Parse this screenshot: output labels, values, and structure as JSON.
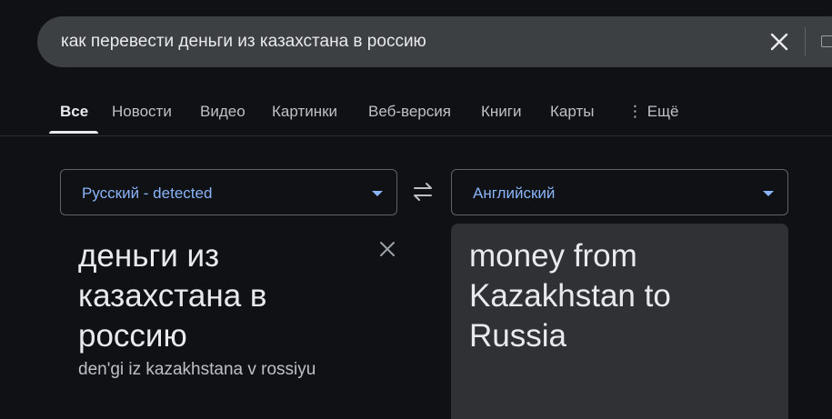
{
  "search": {
    "query": "как перевести деньги из казахстана в россию",
    "clear_icon": "close-icon",
    "keyboard_icon": "keyboard-icon"
  },
  "tabs": [
    {
      "label": "Все",
      "active": true
    },
    {
      "label": "Новости"
    },
    {
      "label": "Видео"
    },
    {
      "label": "Картинки"
    },
    {
      "label": "Веб-версия"
    },
    {
      "label": "Книги"
    },
    {
      "label": "Карты"
    },
    {
      "label": "⋮ Ещё"
    }
  ],
  "translator": {
    "source_lang": "Русский - detected",
    "target_lang": "Английский",
    "source_text": "деньги из казахстана в россию",
    "transliteration": "den'gi iz kazakhstana v rossiyu",
    "translation": "money from Kazakhstan to Russia",
    "swap_icon": "swap-arrows-icon",
    "clear_icon": "close-icon"
  },
  "colors": {
    "background": "#0f1115",
    "search_bar": "#3c4043",
    "accent_blue": "#8ab4f8",
    "target_panel": "#303134"
  }
}
